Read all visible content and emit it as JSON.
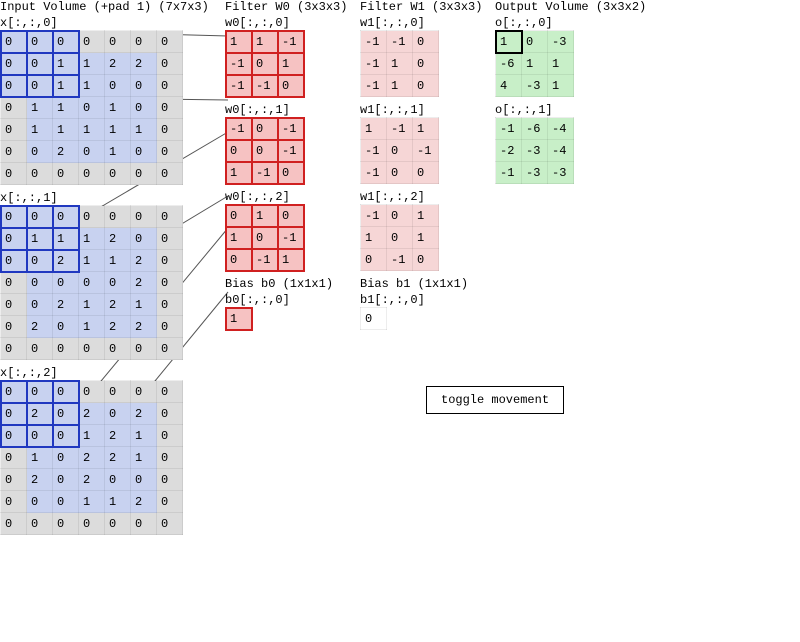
{
  "titles": {
    "input": "Input Volume (+pad 1) (7x7x3)",
    "w0": "Filter W0 (3x3x3)",
    "w1": "Filter W1 (3x3x3)",
    "out": "Output Volume (3x3x2)",
    "bias0": "Bias b0 (1x1x1)",
    "bias1": "Bias b1 (1x1x1)"
  },
  "toggle_label": "toggle movement",
  "input": {
    "slices": [
      {
        "label": "x[:,:,0]",
        "rows": [
          [
            0,
            0,
            0,
            0,
            0,
            0,
            0
          ],
          [
            0,
            0,
            1,
            1,
            2,
            2,
            0
          ],
          [
            0,
            0,
            1,
            1,
            0,
            0,
            0
          ],
          [
            0,
            1,
            1,
            0,
            1,
            0,
            0
          ],
          [
            0,
            1,
            1,
            1,
            1,
            1,
            0
          ],
          [
            0,
            0,
            2,
            0,
            1,
            0,
            0
          ],
          [
            0,
            0,
            0,
            0,
            0,
            0,
            0
          ]
        ]
      },
      {
        "label": "x[:,:,1]",
        "rows": [
          [
            0,
            0,
            0,
            0,
            0,
            0,
            0
          ],
          [
            0,
            1,
            1,
            1,
            2,
            0,
            0
          ],
          [
            0,
            0,
            2,
            1,
            1,
            2,
            0
          ],
          [
            0,
            0,
            0,
            0,
            0,
            2,
            0
          ],
          [
            0,
            0,
            2,
            1,
            2,
            1,
            0
          ],
          [
            0,
            2,
            0,
            1,
            2,
            2,
            0
          ],
          [
            0,
            0,
            0,
            0,
            0,
            0,
            0
          ]
        ]
      },
      {
        "label": "x[:,:,2]",
        "rows": [
          [
            0,
            0,
            0,
            0,
            0,
            0,
            0
          ],
          [
            0,
            2,
            0,
            2,
            0,
            2,
            0
          ],
          [
            0,
            0,
            0,
            1,
            2,
            1,
            0
          ],
          [
            0,
            1,
            0,
            2,
            2,
            1,
            0
          ],
          [
            0,
            2,
            0,
            2,
            0,
            0,
            0
          ],
          [
            0,
            0,
            0,
            1,
            1,
            2,
            0
          ],
          [
            0,
            0,
            0,
            0,
            0,
            0,
            0
          ]
        ]
      }
    ],
    "selection": {
      "r0": 0,
      "c0": 0,
      "size": 3
    }
  },
  "w0": {
    "slices": [
      {
        "label": "w0[:,:,0]",
        "rows": [
          [
            1,
            1,
            -1
          ],
          [
            -1,
            0,
            1
          ],
          [
            -1,
            -1,
            0
          ]
        ]
      },
      {
        "label": "w0[:,:,1]",
        "rows": [
          [
            -1,
            0,
            -1
          ],
          [
            0,
            0,
            -1
          ],
          [
            1,
            -1,
            0
          ]
        ]
      },
      {
        "label": "w0[:,:,2]",
        "rows": [
          [
            0,
            1,
            0
          ],
          [
            1,
            0,
            -1
          ],
          [
            0,
            -1,
            1
          ]
        ]
      }
    ]
  },
  "w1": {
    "slices": [
      {
        "label": "w1[:,:,0]",
        "rows": [
          [
            -1,
            -1,
            0
          ],
          [
            -1,
            1,
            0
          ],
          [
            -1,
            1,
            0
          ]
        ]
      },
      {
        "label": "w1[:,:,1]",
        "rows": [
          [
            1,
            -1,
            1
          ],
          [
            -1,
            0,
            -1
          ],
          [
            -1,
            0,
            0
          ]
        ]
      },
      {
        "label": "w1[:,:,2]",
        "rows": [
          [
            -1,
            0,
            1
          ],
          [
            1,
            0,
            1
          ],
          [
            0,
            -1,
            0
          ]
        ]
      }
    ]
  },
  "output": {
    "slices": [
      {
        "label": "o[:,:,0]",
        "rows": [
          [
            1,
            0,
            -3
          ],
          [
            -6,
            1,
            1
          ],
          [
            4,
            -3,
            1
          ]
        ]
      },
      {
        "label": "o[:,:,1]",
        "rows": [
          [
            -1,
            -6,
            -4
          ],
          [
            -2,
            -3,
            -4
          ],
          [
            -1,
            -3,
            -3
          ]
        ]
      }
    ],
    "selection": {
      "slice": 0,
      "r": 0,
      "c": 0
    }
  },
  "bias": {
    "b0": {
      "label": "b0[:,:,0]",
      "value": 1
    },
    "b1": {
      "label": "b1[:,:,0]",
      "value": 0
    }
  }
}
